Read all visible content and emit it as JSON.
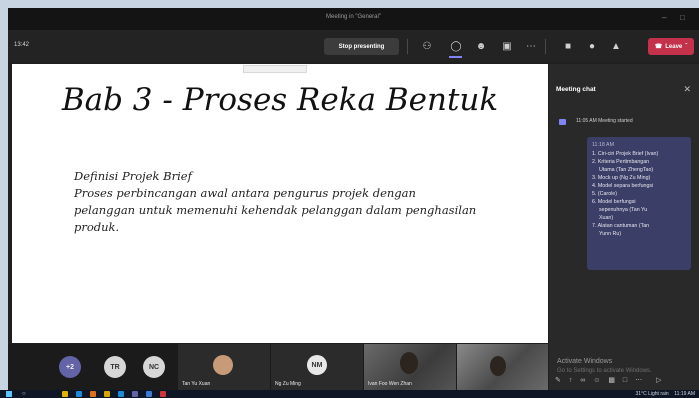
{
  "window": {
    "title": "Meeting in \"General\""
  },
  "toolbar": {
    "time": "13:42",
    "stop_presenting": "Stop presenting",
    "leave": "Leave"
  },
  "slide": {
    "title": "Bab 3 - Proses Reka Bentuk",
    "body_heading": "Definisi Projek Brief",
    "body_lines": [
      "Proses perbincangan awal antara pengurus projek dengan",
      "pelanggan untuk memenuhi kehendak pelanggan dalam penghasilan",
      "produk."
    ]
  },
  "chat": {
    "header": "Meeting chat",
    "event_text": "11:05 AM   Meeting started",
    "message_time": "11:18 AM",
    "message_lines": [
      "1. Ciri-ciri Projek Brief (Ivan)",
      "2. Kriteria Pertimbangan",
      "Utama (Tan ZhengTao)",
      "3. Mock up (Ng Zu Ming)",
      "4. Model separa berfungsi",
      "5. (Carole)",
      "6. Model berfungsi",
      "sepenuhnya (Tan Yu",
      "Xuan)",
      "7. Alatan cantuman (Tan",
      "Yunn Ru)"
    ],
    "watermark_title": "Activate Windows",
    "watermark_sub": "Go to Settings to activate Windows."
  },
  "participants": {
    "overflow": "+2",
    "initials": [
      "TR",
      "NC",
      "NM"
    ],
    "names": [
      "Tan Yu Xuan",
      "Ng Zu Ming",
      "Ivan Foo Wen Zhan"
    ]
  },
  "taskbar": {
    "weather": "31°C  Light rain",
    "clock": "11:19 AM"
  },
  "colors": {
    "accent": "#7f85f5",
    "leave": "#c4314b",
    "chat_bubble": "#3b3e66"
  }
}
